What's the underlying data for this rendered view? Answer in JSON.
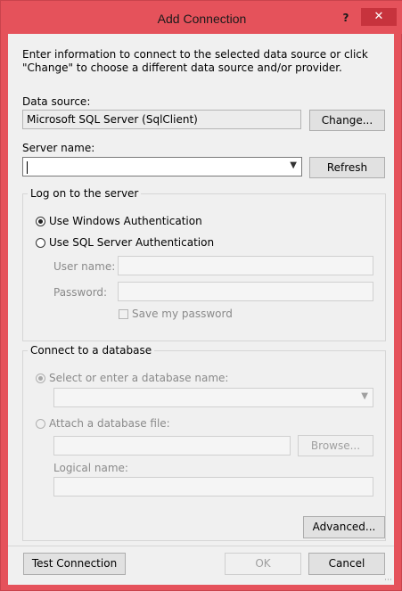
{
  "window": {
    "title": "Add Connection",
    "help_glyph": "?",
    "close_glyph": "✕"
  },
  "intro_text": "Enter information to connect to the selected data source or click \"Change\" to choose a different data source and/or provider.",
  "data_source": {
    "label": "Data source:",
    "value": "Microsoft SQL Server (SqlClient)",
    "change_button": "Change..."
  },
  "server": {
    "label": "Server name:",
    "value": "",
    "refresh_button": "Refresh"
  },
  "logon": {
    "group_label": "Log on to the server",
    "windows_auth_label": "Use Windows Authentication",
    "sql_auth_label": "Use SQL Server Authentication",
    "user_name_label": "User name:",
    "password_label": "Password:",
    "save_password_label": "Save my password"
  },
  "database": {
    "group_label": "Connect to a database",
    "select_db_label": "Select or enter a database name:",
    "attach_file_label": "Attach a database file:",
    "browse_button": "Browse...",
    "logical_name_label": "Logical name:"
  },
  "footer": {
    "advanced_button": "Advanced...",
    "test_connection_button": "Test Connection",
    "ok_button": "OK",
    "cancel_button": "Cancel"
  },
  "colors": {
    "title_bar": "#e5525b",
    "close_button": "#c7333d",
    "dialog_background": "#f0f0f0"
  }
}
